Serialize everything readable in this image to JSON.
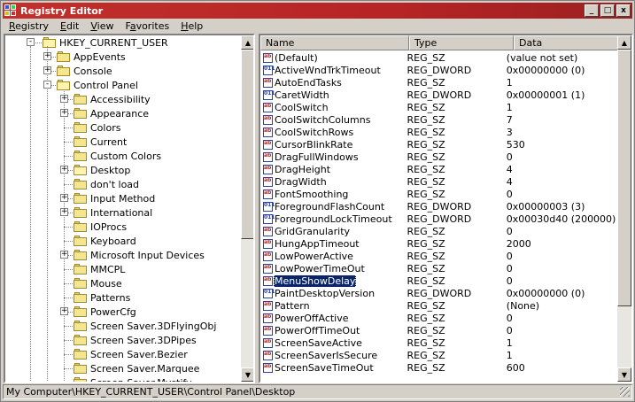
{
  "window": {
    "title": "Registry Editor",
    "minimize_glyph": "_",
    "maximize_glyph": "□",
    "close_glyph": "x"
  },
  "menu": [
    {
      "label": "Registry",
      "accel": "R"
    },
    {
      "label": "Edit",
      "accel": "E"
    },
    {
      "label": "View",
      "accel": "V"
    },
    {
      "label": "Favorites",
      "accel": "a"
    },
    {
      "label": "Help",
      "accel": "H"
    }
  ],
  "tree": {
    "root": "HKEY_CURRENT_USER",
    "items": [
      {
        "label": "AppEvents",
        "level": 1,
        "expander": "+"
      },
      {
        "label": "Console",
        "level": 1,
        "expander": "+"
      },
      {
        "label": "Control Panel",
        "level": 1,
        "expander": "-",
        "open": true
      },
      {
        "label": "Accessibility",
        "level": 2,
        "expander": "+"
      },
      {
        "label": "Appearance",
        "level": 2,
        "expander": "+"
      },
      {
        "label": "Colors",
        "level": 2,
        "expander": ""
      },
      {
        "label": "Current",
        "level": 2,
        "expander": ""
      },
      {
        "label": "Custom Colors",
        "level": 2,
        "expander": ""
      },
      {
        "label": "Desktop",
        "level": 2,
        "expander": "+",
        "open": true
      },
      {
        "label": "don't load",
        "level": 2,
        "expander": ""
      },
      {
        "label": "Input Method",
        "level": 2,
        "expander": "+"
      },
      {
        "label": "International",
        "level": 2,
        "expander": "+"
      },
      {
        "label": "IOProcs",
        "level": 2,
        "expander": ""
      },
      {
        "label": "Keyboard",
        "level": 2,
        "expander": ""
      },
      {
        "label": "Microsoft Input Devices",
        "level": 2,
        "expander": "+"
      },
      {
        "label": "MMCPL",
        "level": 2,
        "expander": ""
      },
      {
        "label": "Mouse",
        "level": 2,
        "expander": ""
      },
      {
        "label": "Patterns",
        "level": 2,
        "expander": ""
      },
      {
        "label": "PowerCfg",
        "level": 2,
        "expander": "+"
      },
      {
        "label": "Screen Saver.3DFlyingObj",
        "level": 2,
        "expander": ""
      },
      {
        "label": "Screen Saver.3DPipes",
        "level": 2,
        "expander": ""
      },
      {
        "label": "Screen Saver.Bezier",
        "level": 2,
        "expander": ""
      },
      {
        "label": "Screen Saver.Marquee",
        "level": 2,
        "expander": ""
      },
      {
        "label": "Screen Saver.Mystify",
        "level": 2,
        "expander": ""
      }
    ]
  },
  "list": {
    "columns": [
      "Name",
      "Type",
      "Data"
    ],
    "rows": [
      {
        "name": "(Default)",
        "type": "REG_SZ",
        "data": "(value not set)"
      },
      {
        "name": "ActiveWndTrkTimeout",
        "type": "REG_DWORD",
        "data": "0x00000000 (0)"
      },
      {
        "name": "AutoEndTasks",
        "type": "REG_SZ",
        "data": "1"
      },
      {
        "name": "CaretWidth",
        "type": "REG_DWORD",
        "data": "0x00000001 (1)"
      },
      {
        "name": "CoolSwitch",
        "type": "REG_SZ",
        "data": "1"
      },
      {
        "name": "CoolSwitchColumns",
        "type": "REG_SZ",
        "data": "7"
      },
      {
        "name": "CoolSwitchRows",
        "type": "REG_SZ",
        "data": "3"
      },
      {
        "name": "CursorBlinkRate",
        "type": "REG_SZ",
        "data": "530"
      },
      {
        "name": "DragFullWindows",
        "type": "REG_SZ",
        "data": "0"
      },
      {
        "name": "DragHeight",
        "type": "REG_SZ",
        "data": "4"
      },
      {
        "name": "DragWidth",
        "type": "REG_SZ",
        "data": "4"
      },
      {
        "name": "FontSmoothing",
        "type": "REG_SZ",
        "data": "0"
      },
      {
        "name": "ForegroundFlashCount",
        "type": "REG_DWORD",
        "data": "0x00000003 (3)"
      },
      {
        "name": "ForegroundLockTimeout",
        "type": "REG_DWORD",
        "data": "0x00030d40 (200000)"
      },
      {
        "name": "GridGranularity",
        "type": "REG_SZ",
        "data": "0"
      },
      {
        "name": "HungAppTimeout",
        "type": "REG_SZ",
        "data": "2000"
      },
      {
        "name": "LowPowerActive",
        "type": "REG_SZ",
        "data": "0"
      },
      {
        "name": "LowPowerTimeOut",
        "type": "REG_SZ",
        "data": "0"
      },
      {
        "name": "MenuShowDelay",
        "type": "REG_SZ",
        "data": "0",
        "selected": true
      },
      {
        "name": "PaintDesktopVersion",
        "type": "REG_DWORD",
        "data": "0x00000000 (0)"
      },
      {
        "name": "Pattern",
        "type": "REG_SZ",
        "data": "(None)"
      },
      {
        "name": "PowerOffActive",
        "type": "REG_SZ",
        "data": "0"
      },
      {
        "name": "PowerOffTimeOut",
        "type": "REG_SZ",
        "data": "0"
      },
      {
        "name": "ScreenSaveActive",
        "type": "REG_SZ",
        "data": "1"
      },
      {
        "name": "ScreenSaverIsSecure",
        "type": "REG_SZ",
        "data": "1"
      },
      {
        "name": "ScreenSaveTimeOut",
        "type": "REG_SZ",
        "data": "600"
      }
    ]
  },
  "statusbar": {
    "path": "My Computer\\HKEY_CURRENT_USER\\Control Panel\\Desktop"
  },
  "colors": {
    "title_bar": "#c0302c",
    "selection": "#0a246a",
    "chrome": "#d4d0c8"
  }
}
